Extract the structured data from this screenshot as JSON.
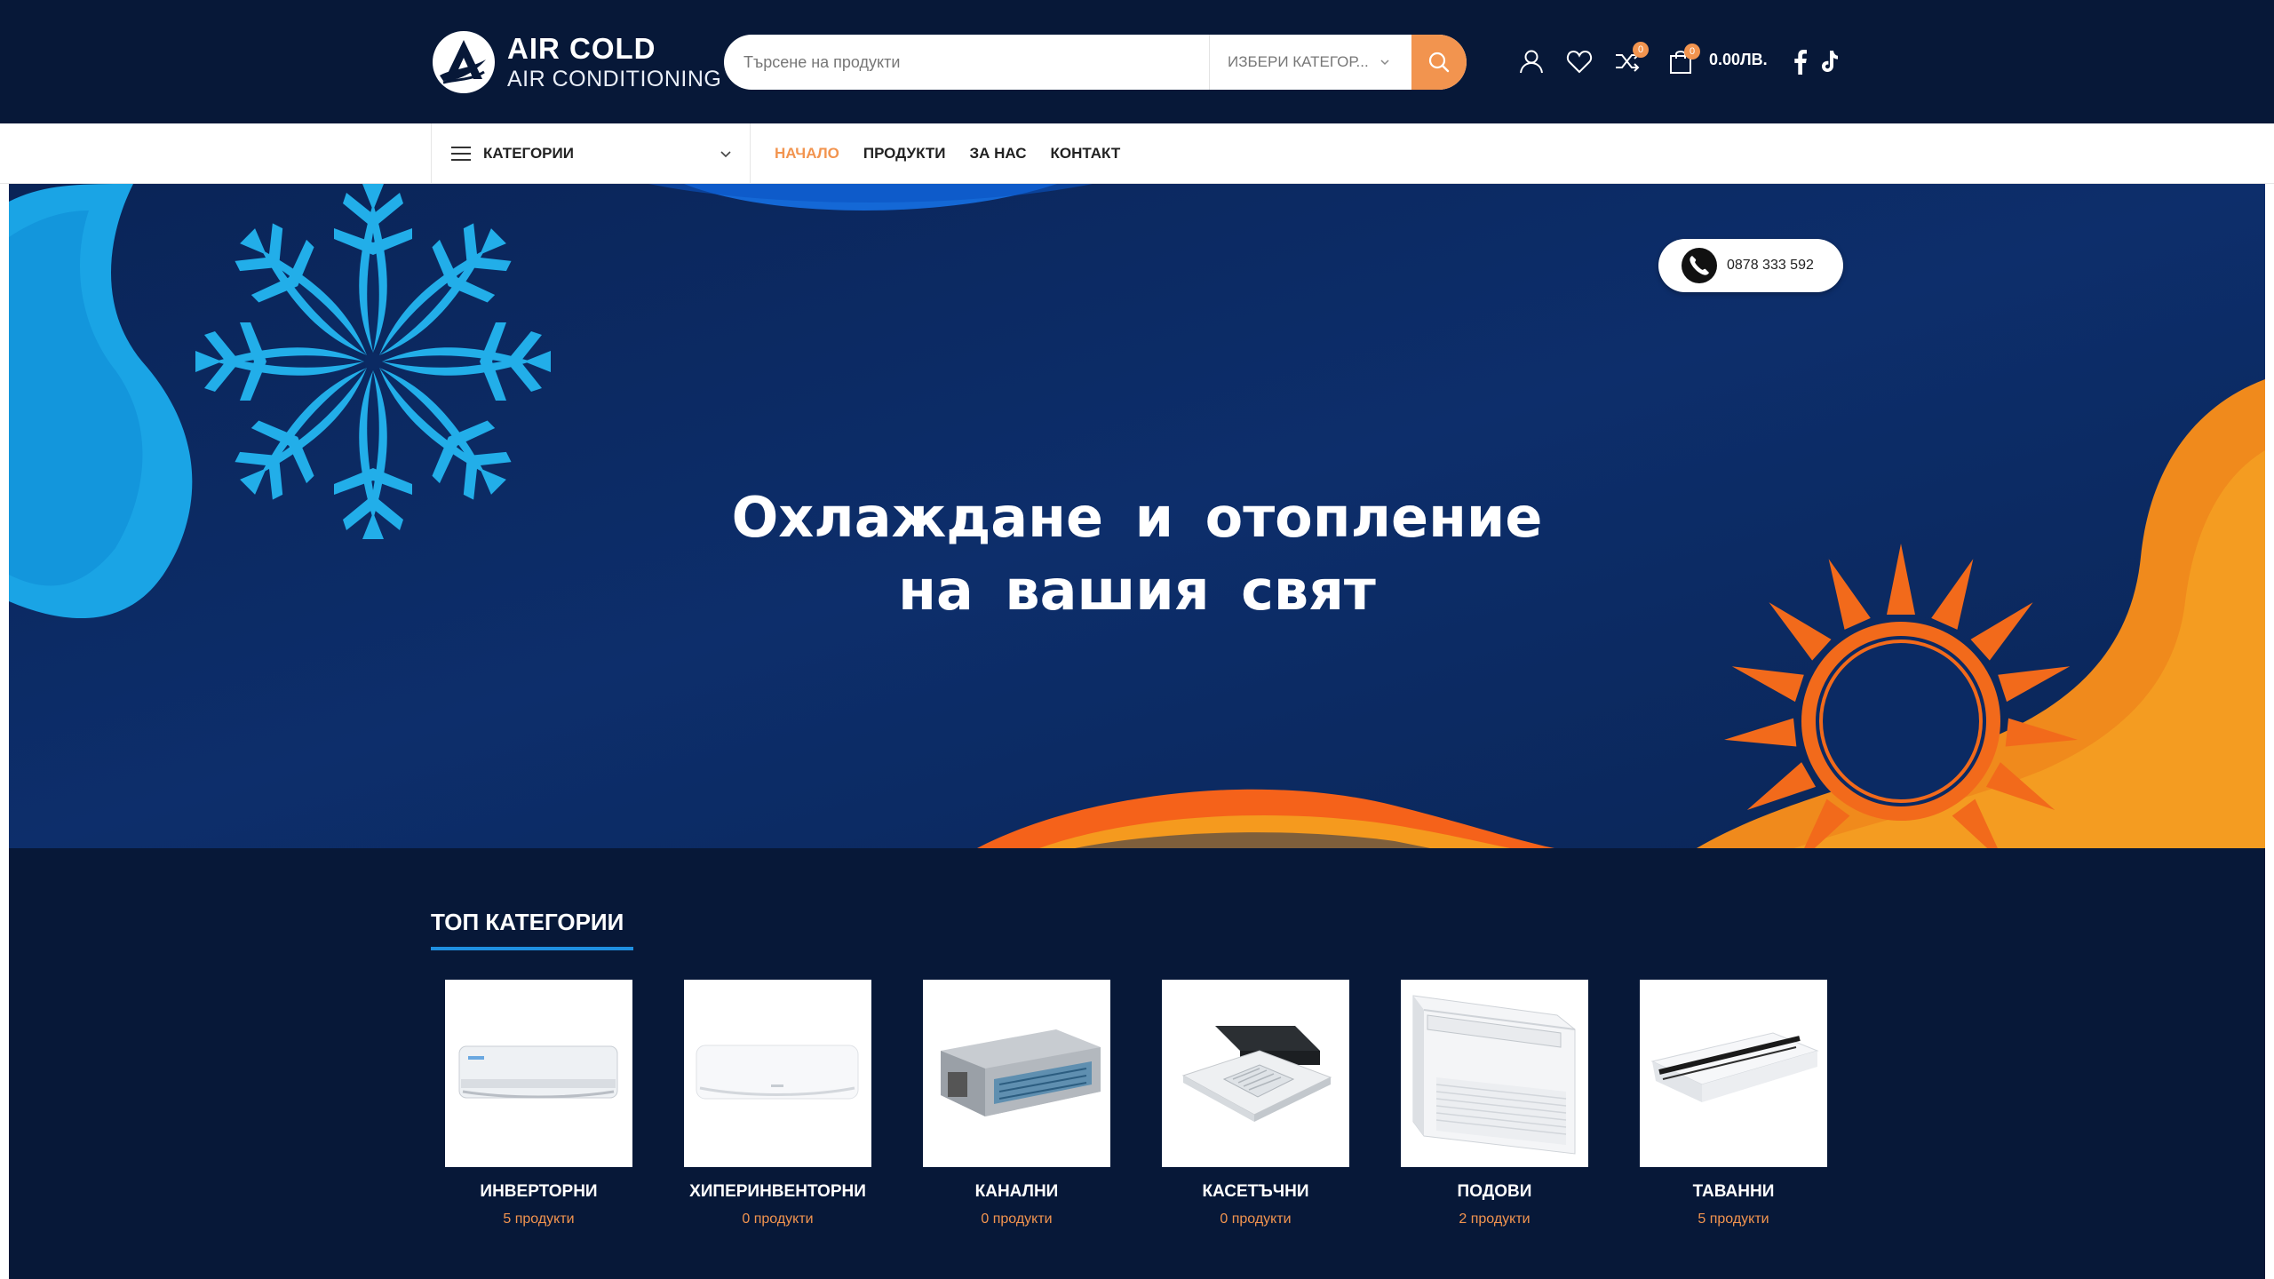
{
  "header": {
    "logo_line1": "AIR COLD",
    "logo_line2": "AIR CONDITIONING",
    "search_placeholder": "Търсене на продукти",
    "search_category": "ИЗБЕРИ КАТЕГОР...",
    "compare_badge": "0",
    "cart_badge": "0",
    "cart_total": "0.00ЛВ."
  },
  "nav": {
    "categories_label": "КАТЕГОРИИ",
    "menu": [
      {
        "label": "НАЧАЛО",
        "active": true
      },
      {
        "label": "ПРОДУКТИ",
        "active": false
      },
      {
        "label": "ЗА НАС",
        "active": false
      },
      {
        "label": "КОНТАКТ",
        "active": false
      }
    ]
  },
  "hero": {
    "phone": "0878 333 592",
    "title_line1": "Охлаждане и отопление",
    "title_line2": "на вашия свят"
  },
  "top_categories": {
    "title": "ТОП КАТЕГОРИИ",
    "items": [
      {
        "name": "ИНВЕРТОРНИ",
        "count": "5 продукти",
        "icon": "wall-split-ac"
      },
      {
        "name": "ХИПЕРИНВЕНТОРНИ",
        "count": "0 продукти",
        "icon": "wall-split-ac-white"
      },
      {
        "name": "КАНАЛНИ",
        "count": "0 продукти",
        "icon": "ducted-ac"
      },
      {
        "name": "КАСЕТЪЧНИ",
        "count": "0 продукти",
        "icon": "cassette-ac"
      },
      {
        "name": "ПОДОВИ",
        "count": "2 продукти",
        "icon": "floor-ac"
      },
      {
        "name": "ТАВАННИ",
        "count": "5 продукти",
        "icon": "ceiling-ac"
      }
    ]
  },
  "colors": {
    "header_bg": "#071838",
    "accent": "#f2944f",
    "hero_blue": "#0b2a63",
    "snowflake": "#22aee9",
    "sun_orange": "#f26a1b",
    "underline_blue": "#1f8fe0"
  }
}
